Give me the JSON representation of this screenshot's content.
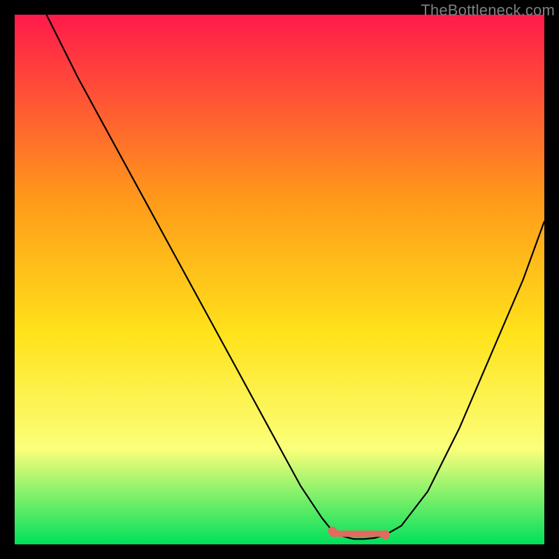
{
  "watermark": "TheBottleneck.com",
  "colors": {
    "gradient_top": "#ff1a4b",
    "gradient_mid1": "#ff9a1a",
    "gradient_mid2": "#ffe21a",
    "gradient_mid3": "#fbff7a",
    "gradient_bottom": "#00e05a",
    "curve": "#000000",
    "marker": "#e26a5f",
    "frame": "#000000"
  },
  "chart_data": {
    "type": "line",
    "title": "",
    "xlabel": "",
    "ylabel": "",
    "xlim": [
      0,
      100
    ],
    "ylim": [
      0,
      100
    ],
    "series": [
      {
        "name": "curve",
        "x": [
          6,
          8,
          12,
          18,
          24,
          30,
          36,
          42,
          48,
          54,
          58,
          60,
          62,
          64,
          66,
          68,
          70,
          73,
          78,
          84,
          90,
          96,
          100
        ],
        "values": [
          100,
          96,
          88,
          77,
          66,
          55,
          44,
          33,
          22,
          11,
          5,
          2.5,
          1.5,
          1.0,
          1.0,
          1.2,
          1.8,
          3.5,
          10,
          22,
          36,
          50,
          61
        ]
      }
    ],
    "markers": [
      {
        "name": "flat-zone-left",
        "x": 60,
        "y": 2.5
      },
      {
        "name": "flat-zone-right",
        "x": 70,
        "y": 1.8
      }
    ],
    "flat_segment": {
      "x_start": 60,
      "x_end": 70,
      "y": 2.0
    }
  }
}
